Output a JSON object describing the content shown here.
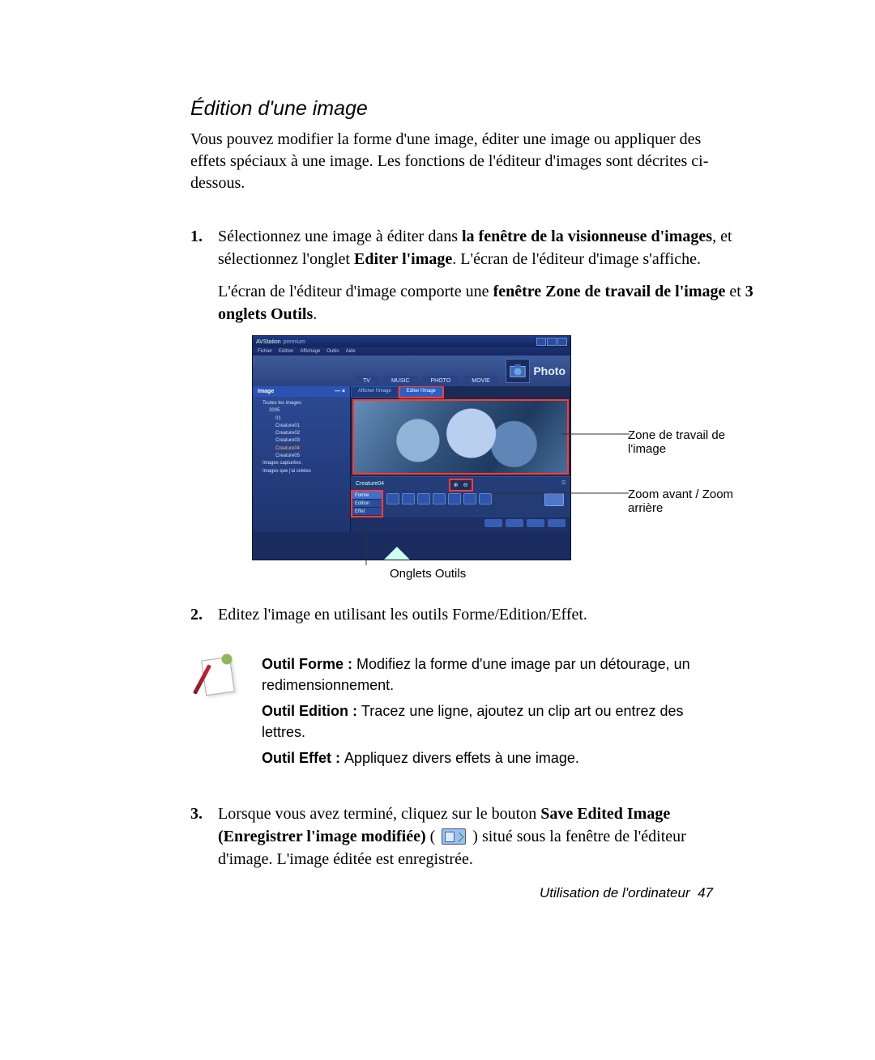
{
  "page": {
    "heading": "Édition d'une image",
    "intro": "Vous pouvez modifier la forme d'une image, éditer une image ou appliquer des effets spéciaux à une image. Les fonctions de l'éditeur d'images sont décrites ci-dessous.",
    "footer_label": "Utilisation de l'ordinateur",
    "footer_page": "47"
  },
  "steps": {
    "s1": {
      "num": "1.",
      "a1": "Sélectionnez une image à éditer dans ",
      "a2": "la fenêtre de la visionneuse d'images",
      "a3": ", et sélectionnez l'onglet ",
      "a4": "Editer l'image",
      "a5": ". L'écran de l'éditeur d'image s'affiche.",
      "b1": "L'écran de l'éditeur d'image comporte une ",
      "b2": "fenêtre Zone de travail de l'image",
      "b3": "  et ",
      "b4": "3 onglets Outils",
      "b5": "."
    },
    "s2": {
      "num": "2.",
      "text": "Editez l'image en utilisant les outils Forme/Edition/Effet."
    },
    "s3": {
      "num": "3.",
      "a1": "Lorsque vous avez terminé, cliquez sur le bouton ",
      "a2": "Save Edited Image (Enregistrer l'image modifiée)",
      "a3": " ( ",
      "a4": " ) situé sous la fenêtre de l'éditeur d'image. L'image éditée est enregistrée."
    }
  },
  "tools_note": {
    "forme_b": "Outil Forme : ",
    "forme": "Modifiez la forme d'une image par un détourage, un redimensionnement.",
    "edition_b": "Outil Edition : ",
    "edition": "Tracez une ligne, ajoutez un clip art ou entrez des lettres.",
    "effet_b": "Outil Effet : ",
    "effet": "Appliquez divers effets à une image."
  },
  "callouts": {
    "workarea": "Zone de travail de l'image",
    "zoom": "Zoom avant / Zoom arrière",
    "tooltabs": "Onglets Outils"
  },
  "screenshot": {
    "app_name": "AVStation",
    "app_suffix": "premium",
    "menus": [
      "Fichier",
      "Edition",
      "Affichage",
      "Outils",
      "Aide"
    ],
    "main_tabs": [
      "TV",
      "MUSIC",
      "PHOTO",
      "MOVIE"
    ],
    "badge": "Photo",
    "side_header": "Image",
    "tree": {
      "root": "Toutes les images",
      "year": "2005",
      "folders": [
        "01",
        "Creature01",
        "Creature02",
        "Creature03",
        "Creature04",
        "Creature05"
      ],
      "selected": "Creature04",
      "extra1": "Images capturées",
      "extra2": "Images que j'ai créées"
    },
    "sub_tabs": {
      "a": "Afficher l'image",
      "b": "Editer l'image"
    },
    "status_name": "Creature04",
    "tool_tabs": [
      "Forme",
      "Edition",
      "Effet"
    ]
  }
}
